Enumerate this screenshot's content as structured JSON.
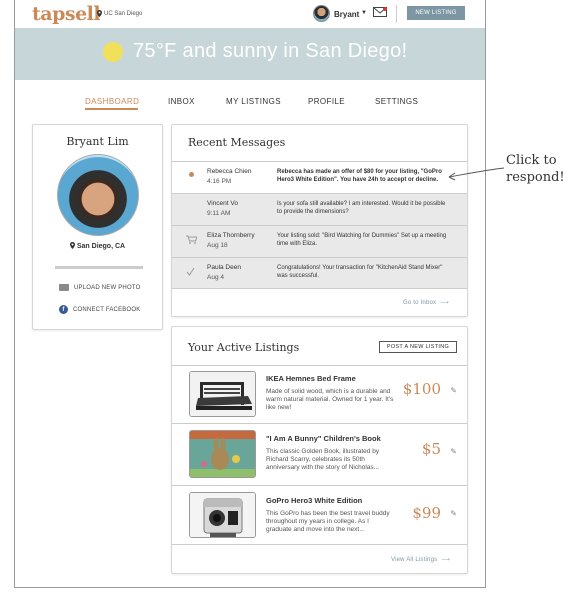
{
  "header": {
    "logo": "tapsell",
    "location": "UC San Diego",
    "user_name": "Bryant",
    "new_listing_label": "NEW LISTING"
  },
  "weather": {
    "text": "75°F and sunny in San Diego!"
  },
  "nav": {
    "items": [
      {
        "label": "DASHBOARD"
      },
      {
        "label": "INBOX"
      },
      {
        "label": "MY LISTINGS"
      },
      {
        "label": "PROFILE"
      },
      {
        "label": "SETTINGS"
      }
    ],
    "active": "DASHBOARD"
  },
  "profile": {
    "name": "Bryant Lim",
    "city": "San Diego, CA",
    "upload_label": "UPLOAD NEW PHOTO",
    "facebook_label": "CONNECT FACEBOOK"
  },
  "messages": {
    "title": "Recent Messages",
    "items": [
      {
        "name": "Rebecca Chien",
        "date": "4:16 PM",
        "text": "Rebecca has made an offer of $80 for your listing, \"GoPro Hero3 White Edition\". You have 24h to accept or decline.",
        "icon": "unread-dot"
      },
      {
        "name": "Vincent Vo",
        "date": "9:11 AM",
        "text": "Is your sofa still available? I am interested. Would it be possible to provide the dimensions?",
        "icon": "none"
      },
      {
        "name": "Eliza Thornberry",
        "date": "Aug 18",
        "text": "Your listing sold: \"Bird Watching for Dummies\" Set up a meeting time with Eliza.",
        "icon": "cart-icon"
      },
      {
        "name": "Paula Deen",
        "date": "Aug 4",
        "text": "Congratulations! Your transaction for \"KitchenAid Stand Mixer\" was successful.",
        "icon": "check-icon"
      }
    ],
    "footer_link": "Go to Inbox"
  },
  "listings": {
    "title": "Your Active Listings",
    "post_button": "POST A NEW LISTING",
    "items": [
      {
        "title": "IKEA Hemnes Bed Frame",
        "desc": "Made of solid wood, which is a durable and warm natural material. Owned for 1 year. It's like new!",
        "price": "$100",
        "thumb": "bed-image"
      },
      {
        "title": "\"I Am A Bunny\" Children's Book",
        "desc": "This classic Golden Book, illustrated by Richard Scarry, celebrates its 50th anniversary with the story of Nicholas...",
        "price": "$5",
        "thumb": "book-image"
      },
      {
        "title": "GoPro Hero3 White Edition",
        "desc": "This GoPro has been the best travel buddy throughout my years in college. As I graduate and move into the next...",
        "price": "$99",
        "thumb": "camera-image"
      }
    ],
    "footer_link": "View All Listings"
  },
  "annotation": {
    "line1": "Click to",
    "line2": "respond!"
  },
  "colors": {
    "accent": "#c98a5a",
    "button": "#7d96a3",
    "weather_bg": "#c7d6d8"
  }
}
